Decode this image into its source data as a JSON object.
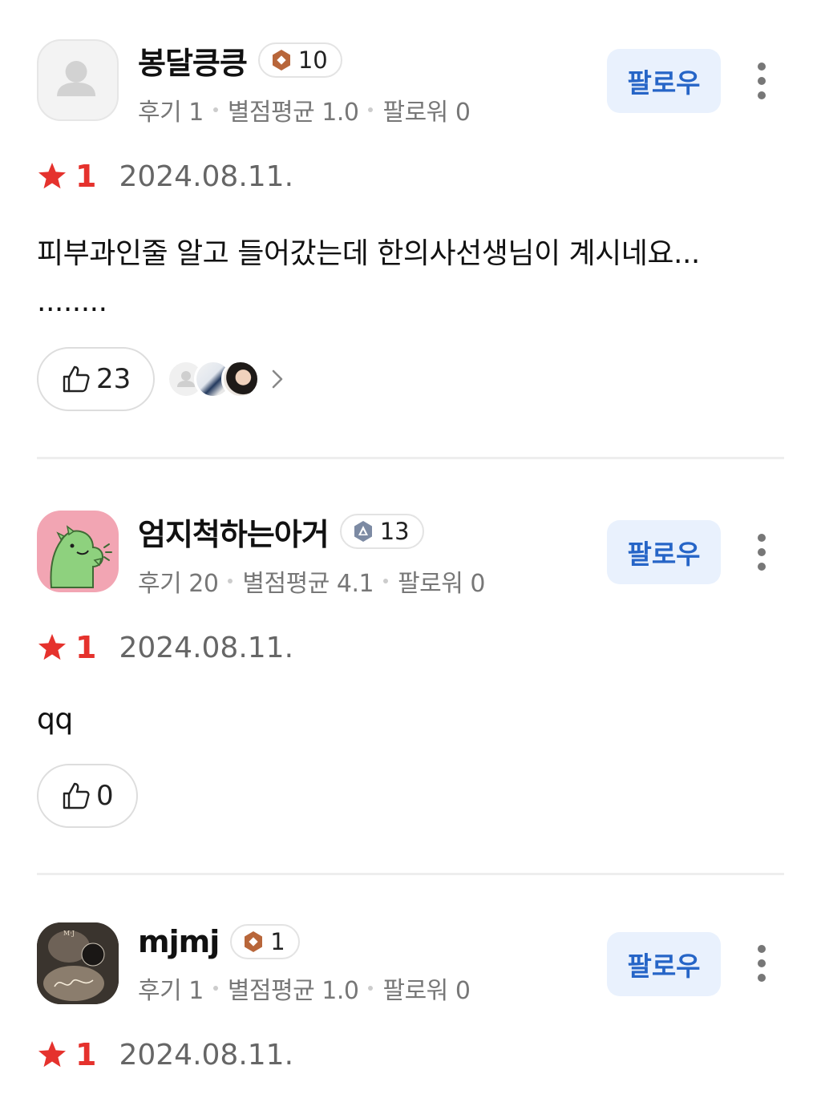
{
  "reviews": [
    {
      "username": "봉달킁킁",
      "level": "10",
      "level_badge": "bronze-hexagon-icon",
      "stats": {
        "reviews": "후기 1",
        "avg_rating": "별점평균 1.0",
        "followers": "팔로워 0"
      },
      "follow_label": "팔로우",
      "rating": "1",
      "date": "2024.08.11.",
      "text": "피부과인줄 알고 들어갔는데 한의사선생님이 계시네요...\n........",
      "likes": "23",
      "liker_avatars": [
        "default-avatar",
        "photo-avatar",
        "photo-avatar"
      ]
    },
    {
      "username": "엄지척하는아거",
      "level": "13",
      "level_badge": "silver-hexagon-icon",
      "stats": {
        "reviews": "후기 20",
        "avg_rating": "별점평균 4.1",
        "followers": "팔로워 0"
      },
      "follow_label": "팔로우",
      "rating": "1",
      "date": "2024.08.11.",
      "text": "qq",
      "likes": "0"
    },
    {
      "username": "mjmj",
      "level": "1",
      "level_badge": "bronze-hexagon-icon",
      "stats": {
        "reviews": "후기 1",
        "avg_rating": "별점평균 1.0",
        "followers": "팔로워 0"
      },
      "follow_label": "팔로우",
      "rating": "1",
      "date": "2024.08.11."
    }
  ],
  "colors": {
    "star": "#e5322d",
    "follow_text": "#2665c7",
    "follow_bg": "#e9f1fd",
    "bronze_badge": "#b8663a",
    "silver_badge": "#7c8aa3"
  }
}
